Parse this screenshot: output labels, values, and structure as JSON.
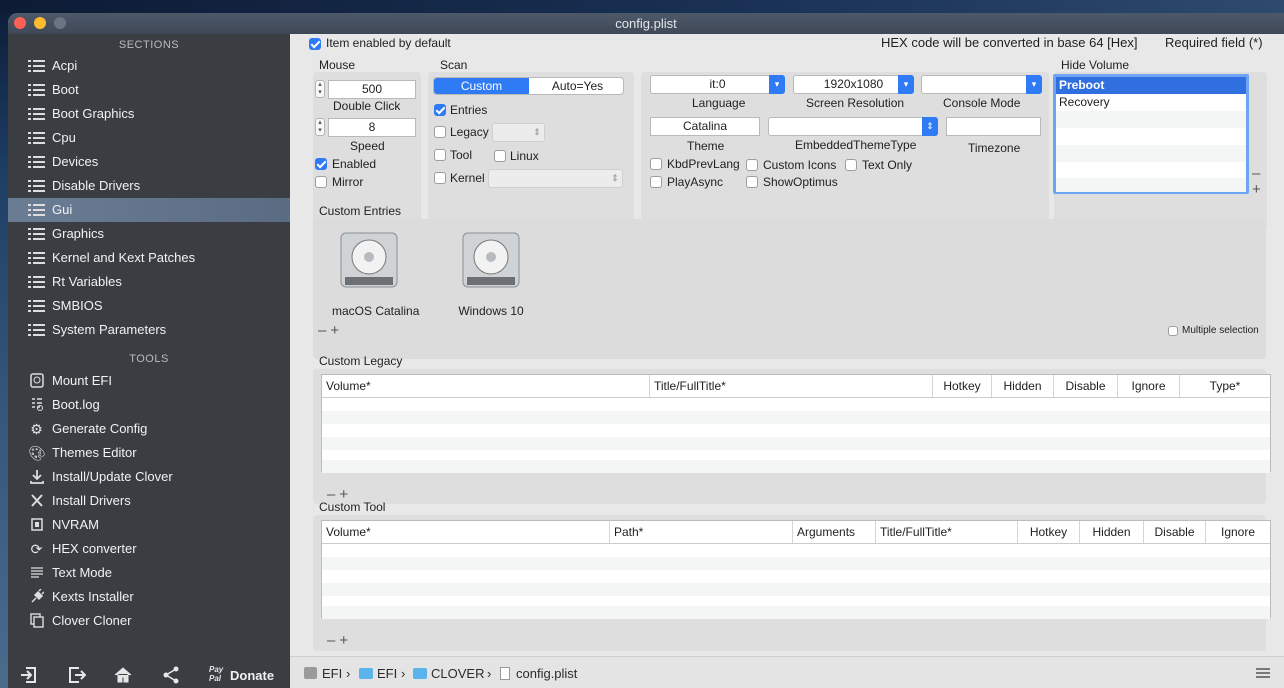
{
  "window": {
    "title": "config.plist"
  },
  "sidebar": {
    "sections_title": "SECTIONS",
    "sections": [
      {
        "label": "Acpi"
      },
      {
        "label": "Boot"
      },
      {
        "label": "Boot Graphics"
      },
      {
        "label": "Cpu"
      },
      {
        "label": "Devices"
      },
      {
        "label": "Disable Drivers"
      },
      {
        "label": "Gui",
        "selected": true
      },
      {
        "label": "Graphics"
      },
      {
        "label": "Kernel and Kext Patches"
      },
      {
        "label": "Rt Variables"
      },
      {
        "label": "SMBIOS"
      },
      {
        "label": "System Parameters"
      }
    ],
    "tools_title": "TOOLS",
    "tools": [
      {
        "label": "Mount EFI",
        "icon": "disk-icon"
      },
      {
        "label": "Boot.log",
        "icon": "log-icon"
      },
      {
        "label": "Generate Config",
        "icon": "gears-icon"
      },
      {
        "label": "Themes Editor",
        "icon": "brush-icon"
      },
      {
        "label": "Install/Update Clover",
        "icon": "download-icon"
      },
      {
        "label": "Install Drivers",
        "icon": "tools-icon"
      },
      {
        "label": "NVRAM",
        "icon": "chip-icon"
      },
      {
        "label": "HEX converter",
        "icon": "refresh-icon"
      },
      {
        "label": "Text Mode",
        "icon": "text-icon"
      },
      {
        "label": "Kexts Installer",
        "icon": "plug-icon"
      },
      {
        "label": "Clover Cloner",
        "icon": "copy-icon"
      }
    ],
    "bottom": {
      "paypal": "Pay Pal",
      "donate": "Donate"
    }
  },
  "top": {
    "item_enabled": "Item enabled by default",
    "hex_note": "HEX code will be converted in base 64 [Hex]",
    "required": "Required field (*)"
  },
  "mouse": {
    "title": "Mouse",
    "double_click_value": "500",
    "double_click_label": "Double Click",
    "speed_value": "8",
    "speed_label": "Speed",
    "enabled": "Enabled",
    "mirror": "Mirror"
  },
  "scan": {
    "title": "Scan",
    "seg_custom": "Custom",
    "seg_auto": "Auto=Yes",
    "entries": "Entries",
    "legacy": "Legacy",
    "tool": "Tool",
    "linux": "Linux",
    "kernel": "Kernel"
  },
  "display": {
    "language_value": "it:0",
    "language_label": "Language",
    "resolution_value": "1920x1080",
    "resolution_label": "Screen Resolution",
    "console_label": "Console Mode",
    "theme_value": "Catalina",
    "theme_label": "Theme",
    "embedded_label": "EmbeddedThemeType",
    "timezone_label": "Timezone",
    "kbd": "KbdPrevLang",
    "custom_icons": "Custom Icons",
    "text_only": "Text Only",
    "play_async": "PlayAsync",
    "show_optimus": "ShowOptimus"
  },
  "hide_volume": {
    "title": "Hide Volume",
    "items": [
      "Preboot",
      "Recovery"
    ]
  },
  "custom_entries": {
    "title": "Custom Entries",
    "items": [
      "macOS Catalina",
      "Windows 10"
    ],
    "multiple_selection": "Multiple selection"
  },
  "custom_legacy": {
    "title": "Custom Legacy",
    "columns": [
      "Volume*",
      "Title/FullTitle*",
      "Hotkey",
      "Hidden",
      "Disable",
      "Ignore",
      "Type*"
    ]
  },
  "custom_tool": {
    "title": "Custom Tool",
    "columns": [
      "Volume*",
      "Path*",
      "Arguments",
      "Title/FullTitle*",
      "Hotkey",
      "Hidden",
      "Disable",
      "Ignore"
    ]
  },
  "pathbar": {
    "crumbs": [
      "EFI",
      "EFI",
      "CLOVER",
      "config.plist"
    ],
    "sep": "›"
  },
  "colors": {
    "accent": "#2f7bf5",
    "sidebar_bg": "#3a3d42",
    "selected_row": "#6b7d95"
  }
}
